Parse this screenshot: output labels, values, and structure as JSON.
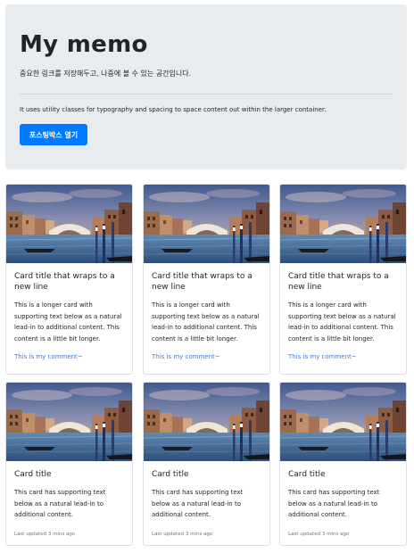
{
  "jumbotron": {
    "title": "My memo",
    "lead": "중요한 링크를 저장해두고, 나중에 볼 수 있는 공간입니다.",
    "description": "It uses utility classes for typography and spacing to space content out within the larger container.",
    "button_label": "포스팅박스 열기",
    "button_color": "#007bff",
    "background": "#e9ecef"
  },
  "cards_row1": [
    {
      "title": "Card title that wraps to a new line",
      "text": "This is a longer card with supporting text below as a natural lead-in to additional content. This content is a little bit longer.",
      "comment": "This is my comment~",
      "image": "venice-grand-canal-photo"
    },
    {
      "title": "Card title that wraps to a new line",
      "text": "This is a longer card with supporting text below as a natural lead-in to additional content. This content is a little bit longer.",
      "comment": "This is my comment~",
      "image": "venice-grand-canal-photo"
    },
    {
      "title": "Card title that wraps to a new line",
      "text": "This is a longer card with supporting text below as a natural lead-in to additional content. This content is a little bit longer.",
      "comment": "This is my comment~",
      "image": "venice-grand-canal-photo"
    }
  ],
  "cards_row2": [
    {
      "title": "Card title",
      "text": "This card has supporting text below as a natural lead-in to additional content.",
      "updated": "Last updated 3 mins ago",
      "image": "venice-grand-canal-photo"
    },
    {
      "title": "Card title",
      "text": "This card has supporting text below as a natural lead-in to additional content.",
      "updated": "Last updated 3 mins ago",
      "image": "venice-grand-canal-photo"
    },
    {
      "title": "Card title",
      "text": "This card has supporting text below as a natural lead-in to additional content.",
      "updated": "Last updated 3 mins ago",
      "image": "venice-grand-canal-photo"
    }
  ],
  "colors": {
    "comment_link": "#3d7bd6",
    "muted": "#6c757d",
    "card_border": "#dcdfe3"
  }
}
